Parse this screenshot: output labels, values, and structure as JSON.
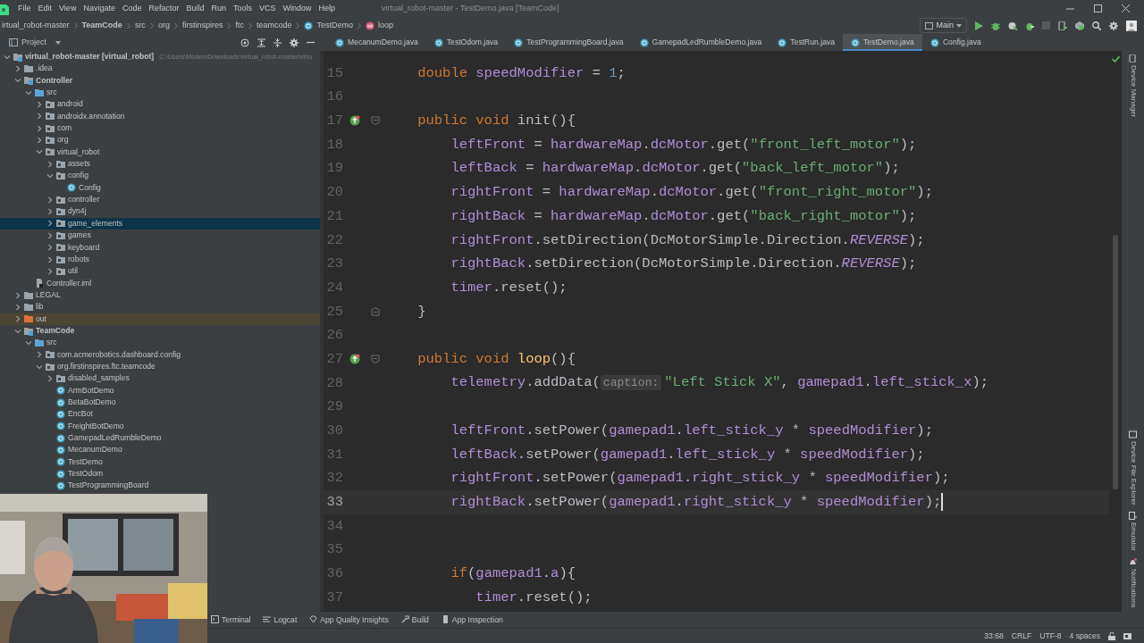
{
  "window": {
    "title": "virtual_robot-master - TestDemo.java [TeamCode]",
    "menus": [
      "File",
      "Edit",
      "View",
      "Navigate",
      "Code",
      "Refactor",
      "Build",
      "Run",
      "Tools",
      "VCS",
      "Window",
      "Help"
    ]
  },
  "breadcrumb": [
    {
      "text": "irtual_robot-master",
      "kind": "plain"
    },
    {
      "text": "TeamCode",
      "kind": "module"
    },
    {
      "text": "src",
      "kind": "plain"
    },
    {
      "text": "org",
      "kind": "plain"
    },
    {
      "text": "firstinspires",
      "kind": "plain"
    },
    {
      "text": "ftc",
      "kind": "plain"
    },
    {
      "text": "teamcode",
      "kind": "plain"
    },
    {
      "text": "TestDemo",
      "kind": "class"
    },
    {
      "text": "loop",
      "kind": "method"
    }
  ],
  "toolbar": {
    "run_config": "Main"
  },
  "project_panel": {
    "title": "Project",
    "tree": [
      {
        "name": "virtual_robot-master **[virtual_robot]**",
        "path": "C:\\Users\\Moden\\Downloads\\virtual_robot-master\\virtu",
        "kind": "module",
        "expanded": true,
        "selected": false,
        "children": [
          {
            "name": ".idea",
            "kind": "folder",
            "expanded": false,
            "selected": false
          },
          {
            "name": "Controller",
            "kind": "module",
            "expanded": true,
            "selected": false,
            "children": [
              {
                "name": "src",
                "kind": "source",
                "expanded": true,
                "selected": false,
                "children": [
                  {
                    "name": "android",
                    "kind": "package",
                    "expanded": false,
                    "selected": false
                  },
                  {
                    "name": "androidx.annotation",
                    "kind": "package",
                    "expanded": false,
                    "selected": false
                  },
                  {
                    "name": "com",
                    "kind": "package",
                    "expanded": false,
                    "selected": false
                  },
                  {
                    "name": "org",
                    "kind": "package",
                    "expanded": false,
                    "selected": false
                  },
                  {
                    "name": "virtual_robot",
                    "kind": "package",
                    "expanded": true,
                    "selected": false,
                    "children": [
                      {
                        "name": "assets",
                        "kind": "package",
                        "expanded": false,
                        "selected": false
                      },
                      {
                        "name": "config",
                        "kind": "package",
                        "expanded": true,
                        "selected": false,
                        "children": [
                          {
                            "name": "Config",
                            "kind": "class",
                            "selected": false
                          }
                        ]
                      },
                      {
                        "name": "controller",
                        "kind": "package",
                        "expanded": false,
                        "selected": false
                      },
                      {
                        "name": "dyn4j",
                        "kind": "package",
                        "expanded": false,
                        "selected": false
                      },
                      {
                        "name": "game_elements",
                        "kind": "package",
                        "expanded": false,
                        "selected": true
                      },
                      {
                        "name": "games",
                        "kind": "package",
                        "expanded": false,
                        "selected": false
                      },
                      {
                        "name": "keyboard",
                        "kind": "package",
                        "expanded": false,
                        "selected": false
                      },
                      {
                        "name": "robots",
                        "kind": "package",
                        "expanded": false,
                        "selected": false
                      },
                      {
                        "name": "util",
                        "kind": "package",
                        "expanded": false,
                        "selected": false
                      }
                    ]
                  }
                ]
              },
              {
                "name": "Controller.iml",
                "kind": "iml",
                "selected": false
              }
            ]
          },
          {
            "name": "LEGAL",
            "kind": "folder",
            "expanded": false,
            "selected": false
          },
          {
            "name": "lib",
            "kind": "folder",
            "expanded": false,
            "selected": false
          },
          {
            "name": "out",
            "kind": "excluded",
            "expanded": false,
            "selected": false
          },
          {
            "name": "TeamCode",
            "kind": "module",
            "expanded": true,
            "selected": false,
            "children": [
              {
                "name": "src",
                "kind": "source",
                "expanded": true,
                "selected": false,
                "children": [
                  {
                    "name": "com.acmerobotics.dashboard.config",
                    "kind": "package",
                    "expanded": false,
                    "selected": false
                  },
                  {
                    "name": "org.firstinspires.ftc.teamcode",
                    "kind": "package",
                    "expanded": true,
                    "selected": false,
                    "children": [
                      {
                        "name": "disabled_samples",
                        "kind": "package",
                        "expanded": false,
                        "selected": false
                      },
                      {
                        "name": "ArmBotDemo",
                        "kind": "class",
                        "selected": false
                      },
                      {
                        "name": "BetaBotDemo",
                        "kind": "class",
                        "selected": false
                      },
                      {
                        "name": "EncBot",
                        "kind": "class",
                        "selected": false
                      },
                      {
                        "name": "FreightBotDemo",
                        "kind": "class",
                        "selected": false
                      },
                      {
                        "name": "GamepadLedRumbleDemo",
                        "kind": "class",
                        "selected": false
                      },
                      {
                        "name": "MecanumDemo",
                        "kind": "class",
                        "selected": false
                      },
                      {
                        "name": "TestDemo",
                        "kind": "class",
                        "selected": false
                      },
                      {
                        "name": "TestOdom",
                        "kind": "class",
                        "selected": false
                      },
                      {
                        "name": "TestProgrammingBoard",
                        "kind": "class",
                        "selected": false
                      }
                    ]
                  }
                ]
              }
            ]
          }
        ]
      }
    ]
  },
  "editor_tabs": [
    {
      "label": "MecanumDemo.java",
      "selected": false
    },
    {
      "label": "TestOdom.java",
      "selected": false
    },
    {
      "label": "TestProgrammingBoard.java",
      "selected": false
    },
    {
      "label": "GamepadLedRumbleDemo.java",
      "selected": false
    },
    {
      "label": "TestRun.java",
      "selected": false
    },
    {
      "label": "TestDemo.java",
      "selected": true
    },
    {
      "label": "Config.java",
      "selected": false
    }
  ],
  "editor": {
    "lines": [
      {
        "number": "15",
        "current": false,
        "code": [
          {
            "kind": "keyword",
            "text": "    double"
          },
          {
            "kind": "field",
            "text": " speedModifier"
          },
          {
            "kind": "plain",
            "text": " = "
          },
          {
            "kind": "number",
            "text": "1"
          },
          {
            "kind": "plain",
            "text": ";"
          }
        ]
      },
      {
        "number": "16",
        "current": false
      },
      {
        "number": "17",
        "current": false,
        "implements_marker": true,
        "fold_start": true,
        "code": [
          {
            "kind": "keyword",
            "text": "    public void"
          },
          {
            "kind": "plain",
            "text": " init(){"
          }
        ]
      },
      {
        "number": "18",
        "current": false,
        "code": [
          {
            "kind": "field",
            "text": "        leftFront"
          },
          {
            "kind": "plain",
            "text": " = "
          },
          {
            "kind": "field",
            "text": "hardwareMap"
          },
          {
            "kind": "plain",
            "text": "."
          },
          {
            "kind": "field",
            "text": "dcMotor"
          },
          {
            "kind": "plain",
            "text": ".get("
          },
          {
            "kind": "string",
            "text": "\"front_left_motor\""
          },
          {
            "kind": "plain",
            "text": ");"
          }
        ]
      },
      {
        "number": "19",
        "current": false,
        "code": [
          {
            "kind": "field",
            "text": "        leftBack"
          },
          {
            "kind": "plain",
            "text": " = "
          },
          {
            "kind": "field",
            "text": "hardwareMap"
          },
          {
            "kind": "plain",
            "text": "."
          },
          {
            "kind": "field",
            "text": "dcMotor"
          },
          {
            "kind": "plain",
            "text": ".get("
          },
          {
            "kind": "string",
            "text": "\"back_left_motor\""
          },
          {
            "kind": "plain",
            "text": ");"
          }
        ]
      },
      {
        "number": "20",
        "current": false,
        "code": [
          {
            "kind": "field",
            "text": "        rightFront"
          },
          {
            "kind": "plain",
            "text": " = "
          },
          {
            "kind": "field",
            "text": "hardwareMap"
          },
          {
            "kind": "plain",
            "text": "."
          },
          {
            "kind": "field",
            "text": "dcMotor"
          },
          {
            "kind": "plain",
            "text": ".get("
          },
          {
            "kind": "string",
            "text": "\"front_right_motor\""
          },
          {
            "kind": "plain",
            "text": ");"
          }
        ]
      },
      {
        "number": "21",
        "current": false,
        "code": [
          {
            "kind": "field",
            "text": "        rightBack"
          },
          {
            "kind": "plain",
            "text": " = "
          },
          {
            "kind": "field",
            "text": "hardwareMap"
          },
          {
            "kind": "plain",
            "text": "."
          },
          {
            "kind": "field",
            "text": "dcMotor"
          },
          {
            "kind": "plain",
            "text": ".get("
          },
          {
            "kind": "string",
            "text": "\"back_right_motor\""
          },
          {
            "kind": "plain",
            "text": ");"
          }
        ]
      },
      {
        "number": "22",
        "current": false,
        "code": [
          {
            "kind": "field",
            "text": "        rightFront"
          },
          {
            "kind": "plain",
            "text": ".setDirection(DcMotorSimple.Direction."
          },
          {
            "kind": "constant",
            "text": "REVERSE"
          },
          {
            "kind": "plain",
            "text": ");"
          }
        ]
      },
      {
        "number": "23",
        "current": false,
        "code": [
          {
            "kind": "field",
            "text": "        rightBack"
          },
          {
            "kind": "plain",
            "text": ".setDirection(DcMotorSimple.Direction."
          },
          {
            "kind": "constant",
            "text": "REVERSE"
          },
          {
            "kind": "plain",
            "text": ");"
          }
        ]
      },
      {
        "number": "24",
        "current": false,
        "code": [
          {
            "kind": "field",
            "text": "        timer"
          },
          {
            "kind": "plain",
            "text": ".reset();"
          }
        ]
      },
      {
        "number": "25",
        "current": false,
        "fold_end": true,
        "code": [
          {
            "kind": "plain",
            "text": "    }"
          }
        ]
      },
      {
        "number": "26",
        "current": false
      },
      {
        "number": "27",
        "current": false,
        "implements_marker": true,
        "fold_start": true,
        "code": [
          {
            "kind": "keyword",
            "text": "    public void"
          },
          {
            "kind": "method",
            "text": " loop"
          },
          {
            "kind": "plain",
            "text": "(){"
          }
        ]
      },
      {
        "number": "28",
        "current": false,
        "code": [
          {
            "kind": "field",
            "text": "        telemetry"
          },
          {
            "kind": "plain",
            "text": ".addData("
          },
          {
            "kind": "hint",
            "text": "caption:"
          },
          {
            "kind": "string",
            "text": "\"Left Stick X\""
          },
          {
            "kind": "plain",
            "text": ", "
          },
          {
            "kind": "field",
            "text": "gamepad1"
          },
          {
            "kind": "plain",
            "text": "."
          },
          {
            "kind": "field",
            "text": "left_stick_x"
          },
          {
            "kind": "plain",
            "text": ");"
          }
        ]
      },
      {
        "number": "29",
        "current": false
      },
      {
        "number": "30",
        "current": false,
        "code": [
          {
            "kind": "field",
            "text": "        leftFront"
          },
          {
            "kind": "plain",
            "text": ".setPower("
          },
          {
            "kind": "field",
            "text": "gamepad1"
          },
          {
            "kind": "plain",
            "text": "."
          },
          {
            "kind": "field",
            "text": "left_stick_y"
          },
          {
            "kind": "plain",
            "text": " * "
          },
          {
            "kind": "field",
            "text": "speedModifier"
          },
          {
            "kind": "plain",
            "text": ");"
          }
        ]
      },
      {
        "number": "31",
        "current": false,
        "code": [
          {
            "kind": "field",
            "text": "        leftBack"
          },
          {
            "kind": "plain",
            "text": ".setPower("
          },
          {
            "kind": "field",
            "text": "gamepad1"
          },
          {
            "kind": "plain",
            "text": "."
          },
          {
            "kind": "field",
            "text": "left_stick_y"
          },
          {
            "kind": "plain",
            "text": " * "
          },
          {
            "kind": "field",
            "text": "speedModifier"
          },
          {
            "kind": "plain",
            "text": ");"
          }
        ]
      },
      {
        "number": "32",
        "current": false,
        "code": [
          {
            "kind": "field",
            "text": "        rightFront"
          },
          {
            "kind": "plain",
            "text": ".setPower("
          },
          {
            "kind": "field",
            "text": "gamepad1"
          },
          {
            "kind": "plain",
            "text": "."
          },
          {
            "kind": "field",
            "text": "right_stick_y"
          },
          {
            "kind": "plain",
            "text": " * "
          },
          {
            "kind": "field",
            "text": "speedModifier"
          },
          {
            "kind": "plain",
            "text": ");"
          }
        ]
      },
      {
        "number": "33",
        "current": true,
        "code": [
          {
            "kind": "field",
            "text": "        rightBack"
          },
          {
            "kind": "plain",
            "text": ".setPower("
          },
          {
            "kind": "field",
            "text": "gamepad1"
          },
          {
            "kind": "plain",
            "text": "."
          },
          {
            "kind": "field",
            "text": "right_stick_y"
          },
          {
            "kind": "plain",
            "text": " * "
          },
          {
            "kind": "field",
            "text": "speedModifier"
          },
          {
            "kind": "plain",
            "text": ");"
          }
        ]
      },
      {
        "number": "34",
        "current": false
      },
      {
        "number": "35",
        "current": false
      },
      {
        "number": "36",
        "current": false,
        "code": [
          {
            "kind": "keyword",
            "text": "        if"
          },
          {
            "kind": "plain",
            "text": "("
          },
          {
            "kind": "field",
            "text": "gamepad1"
          },
          {
            "kind": "plain",
            "text": "."
          },
          {
            "kind": "field",
            "text": "a"
          },
          {
            "kind": "plain",
            "text": "){"
          }
        ]
      },
      {
        "number": "37",
        "current": false,
        "code": [
          {
            "kind": "field",
            "text": "           timer"
          },
          {
            "kind": "plain",
            "text": ".reset();"
          }
        ]
      }
    ]
  },
  "right_stripe": {
    "top": [
      {
        "label": "Device Manager",
        "kind": "device"
      }
    ],
    "bottom": [
      {
        "label": "Device File Explorer",
        "kind": "explorer"
      },
      {
        "label": "Emulator",
        "kind": "emulator"
      },
      {
        "label": "Notifications",
        "kind": "bell"
      }
    ]
  },
  "tool_windows": [
    {
      "label": "Terminal",
      "kind": "terminal"
    },
    {
      "label": "Logcat",
      "kind": "logcat"
    },
    {
      "label": "App Quality Insights",
      "kind": "quality"
    },
    {
      "label": "Build",
      "kind": "build"
    },
    {
      "label": "App Inspection",
      "kind": "inspection"
    }
  ],
  "status_bar": {
    "position": "33:68",
    "line_separator": "CRLF",
    "encoding": "UTF-8",
    "indent": "4 spaces"
  }
}
